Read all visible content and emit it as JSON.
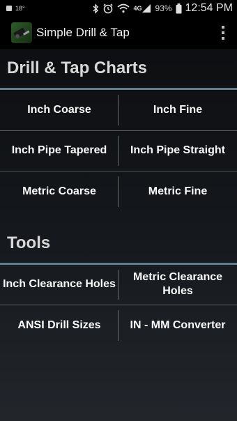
{
  "status_bar": {
    "temperature": "18°",
    "network": "4G",
    "battery": "93%",
    "time": "12:54 PM",
    "icons": [
      "bluetooth-icon",
      "alarm-icon",
      "wifi-icon",
      "signal-icon",
      "battery-icon"
    ]
  },
  "app_bar": {
    "title": "Simple Drill & Tap",
    "icon": "drill-app-icon",
    "menu_icon": "overflow-menu-icon"
  },
  "charts_section": {
    "title": "Drill & Tap Charts",
    "buttons": [
      "Inch Coarse",
      "Inch Fine",
      "Inch Pipe Tapered",
      "Inch Pipe Straight",
      "Metric Coarse",
      "Metric Fine"
    ]
  },
  "tools_section": {
    "title": "Tools",
    "buttons": [
      "Inch Clearance Holes",
      "Metric Clearance Holes",
      "ANSI Drill Sizes",
      "IN - MM Converter"
    ]
  },
  "colors": {
    "section_rule": "#5f7f8f",
    "background_top": "#0b0c0e",
    "background_bottom": "#22262b"
  }
}
